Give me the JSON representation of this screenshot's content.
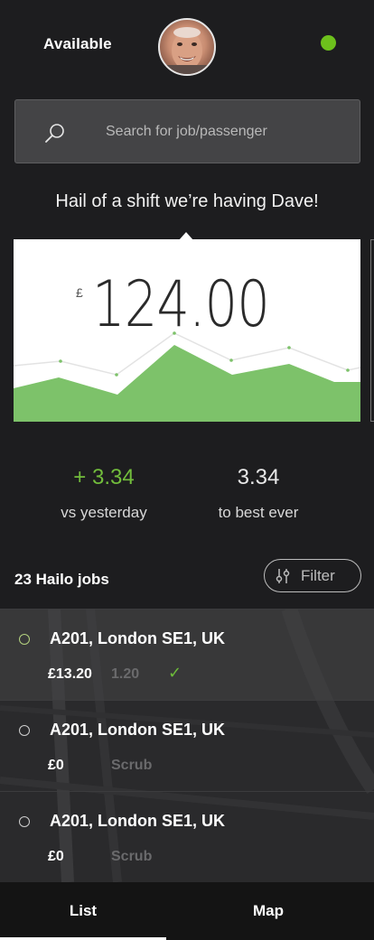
{
  "header": {
    "status": "Available",
    "online_color": "#6dc01c"
  },
  "search": {
    "placeholder": "Search for job/passenger",
    "icon": "search-icon"
  },
  "greeting": "Hail of a shift we’re having Dave!",
  "earnings": {
    "currency": "£",
    "amount": "124.00",
    "accent_color": "#7dc26a"
  },
  "stats": {
    "yesterday_value": "+ 3.34",
    "yesterday_label": "vs yesterday",
    "best_value": "3.34",
    "best_label": "to best ever"
  },
  "jobs": {
    "count_label": "23 Hailo jobs",
    "filter_label": "Filter",
    "items": [
      {
        "address": "A201, London SE1, UK",
        "price": "£13.20",
        "extra": "1.20",
        "check": "✓",
        "selected": true
      },
      {
        "address": "A201, London SE1, UK",
        "price": "£0",
        "extra": "Scrub",
        "selected": false
      },
      {
        "address": "A201, London SE1, UK",
        "price": "£0",
        "extra": "Scrub",
        "selected": false
      }
    ]
  },
  "nav": {
    "list_label": "List",
    "map_label": "Map",
    "active": "List"
  }
}
